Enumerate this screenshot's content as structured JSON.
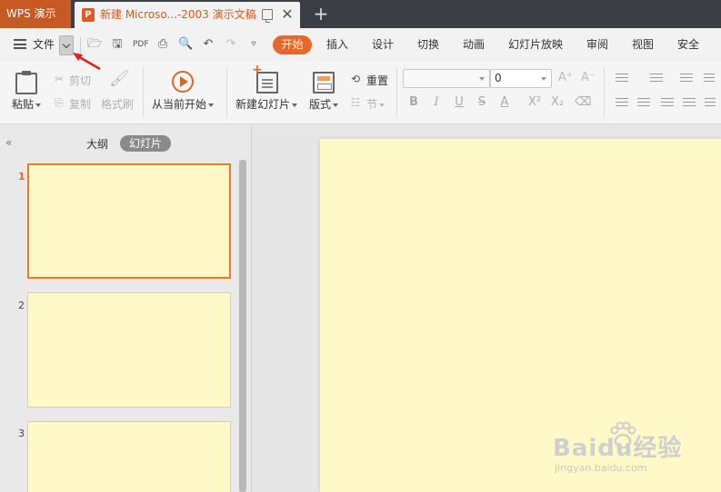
{
  "titlebar": {
    "app_tab": "WPS 演示",
    "doc_tab": "新建 Microso...-2003 演示文稿",
    "doc_icon": "P",
    "new_tab": "+"
  },
  "menu": {
    "file_label": "文件",
    "tabs": [
      "开始",
      "插入",
      "设计",
      "切换",
      "动画",
      "幻灯片放映",
      "审阅",
      "视图",
      "安全"
    ]
  },
  "ribbon": {
    "paste": "粘贴",
    "cut": "剪切",
    "copy": "复制",
    "format_painter": "格式刷",
    "from_current": "从当前开始",
    "new_slide": "新建幻灯片",
    "layout": "版式",
    "reset": "重置",
    "section": "节",
    "font_size": "0"
  },
  "panel": {
    "outline_tab": "大纲",
    "slides_tab": "幻灯片",
    "slides": [
      {
        "number": "1",
        "active": true
      },
      {
        "number": "2",
        "active": false
      },
      {
        "number": "3",
        "active": false
      }
    ]
  },
  "colors": {
    "accent": "#e8672a",
    "slide_bg": "#fff9c8",
    "titlebar": "#3b3f45",
    "app_tab": "#c65a22"
  },
  "watermark": {
    "brand": "Baidu经验",
    "url": "jingyan.baidu.com"
  }
}
